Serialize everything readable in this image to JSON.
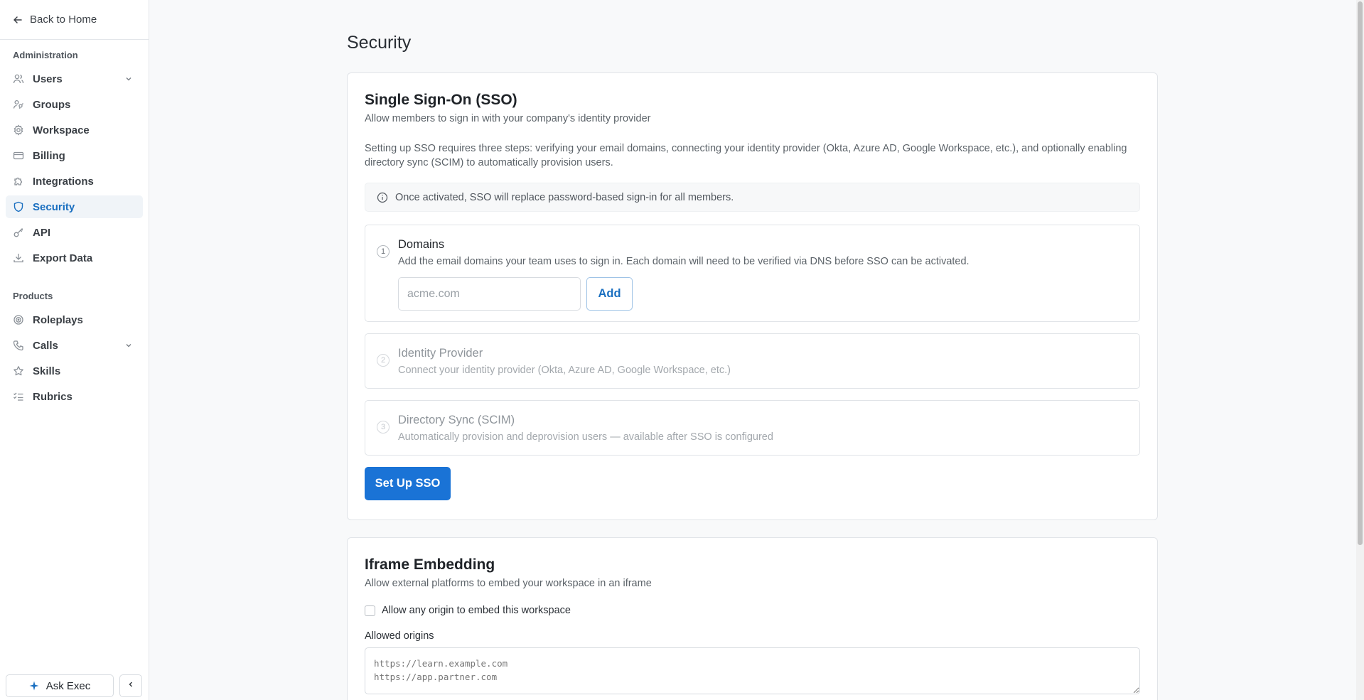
{
  "sidebar": {
    "back_label": "Back to Home",
    "admin_section": "Administration",
    "admin_items": [
      {
        "label": "Users",
        "icon": "users-icon",
        "has_chevron": true
      },
      {
        "label": "Groups",
        "icon": "groups-icon"
      },
      {
        "label": "Workspace",
        "icon": "gear-icon"
      },
      {
        "label": "Billing",
        "icon": "credit-card-icon"
      },
      {
        "label": "Integrations",
        "icon": "puzzle-icon"
      },
      {
        "label": "Security",
        "icon": "shield-icon",
        "active": true
      },
      {
        "label": "API",
        "icon": "key-icon"
      },
      {
        "label": "Export Data",
        "icon": "download-icon"
      }
    ],
    "products_section": "Products",
    "product_items": [
      {
        "label": "Roleplays",
        "icon": "target-icon"
      },
      {
        "label": "Calls",
        "icon": "phone-icon",
        "has_chevron": true
      },
      {
        "label": "Skills",
        "icon": "star-icon"
      },
      {
        "label": "Rubrics",
        "icon": "list-check-icon"
      }
    ],
    "ask_label": "Ask Exec"
  },
  "page": {
    "title": "Security"
  },
  "sso": {
    "title": "Single Sign-On (SSO)",
    "subtitle": "Allow members to sign in with your company's identity provider",
    "description": "Setting up SSO requires three steps: verifying your email domains, connecting your identity provider (Okta, Azure AD, Google Workspace, etc.), and optionally enabling directory sync (SCIM) to automatically provision users.",
    "info": "Once activated, SSO will replace password-based sign-in for all members.",
    "steps": [
      {
        "number": "1",
        "title": "Domains",
        "subtitle": "Add the email domains your team uses to sign in. Each domain will need to be verified via DNS before SSO can be activated."
      },
      {
        "number": "2",
        "title": "Identity Provider",
        "subtitle": "Connect your identity provider (Okta, Azure AD, Google Workspace, etc.)"
      },
      {
        "number": "3",
        "title": "Directory Sync (SCIM)",
        "subtitle": "Automatically provision and deprovision users — available after SSO is configured"
      }
    ],
    "domain_input": {
      "placeholder": "acme.com",
      "value": ""
    },
    "add_label": "Add",
    "setup_label": "Set Up SSO"
  },
  "iframe": {
    "title": "Iframe Embedding",
    "subtitle": "Allow external platforms to embed your workspace in an iframe",
    "checkbox_label": "Allow any origin to embed this workspace",
    "checkbox_checked": false,
    "origins_label": "Allowed origins",
    "origins_placeholder": "https://learn.example.com\nhttps://app.partner.com"
  },
  "colors": {
    "accent": "#1a73d6",
    "active_text": "#1a6fc0",
    "active_bg": "#f0f4f8"
  }
}
